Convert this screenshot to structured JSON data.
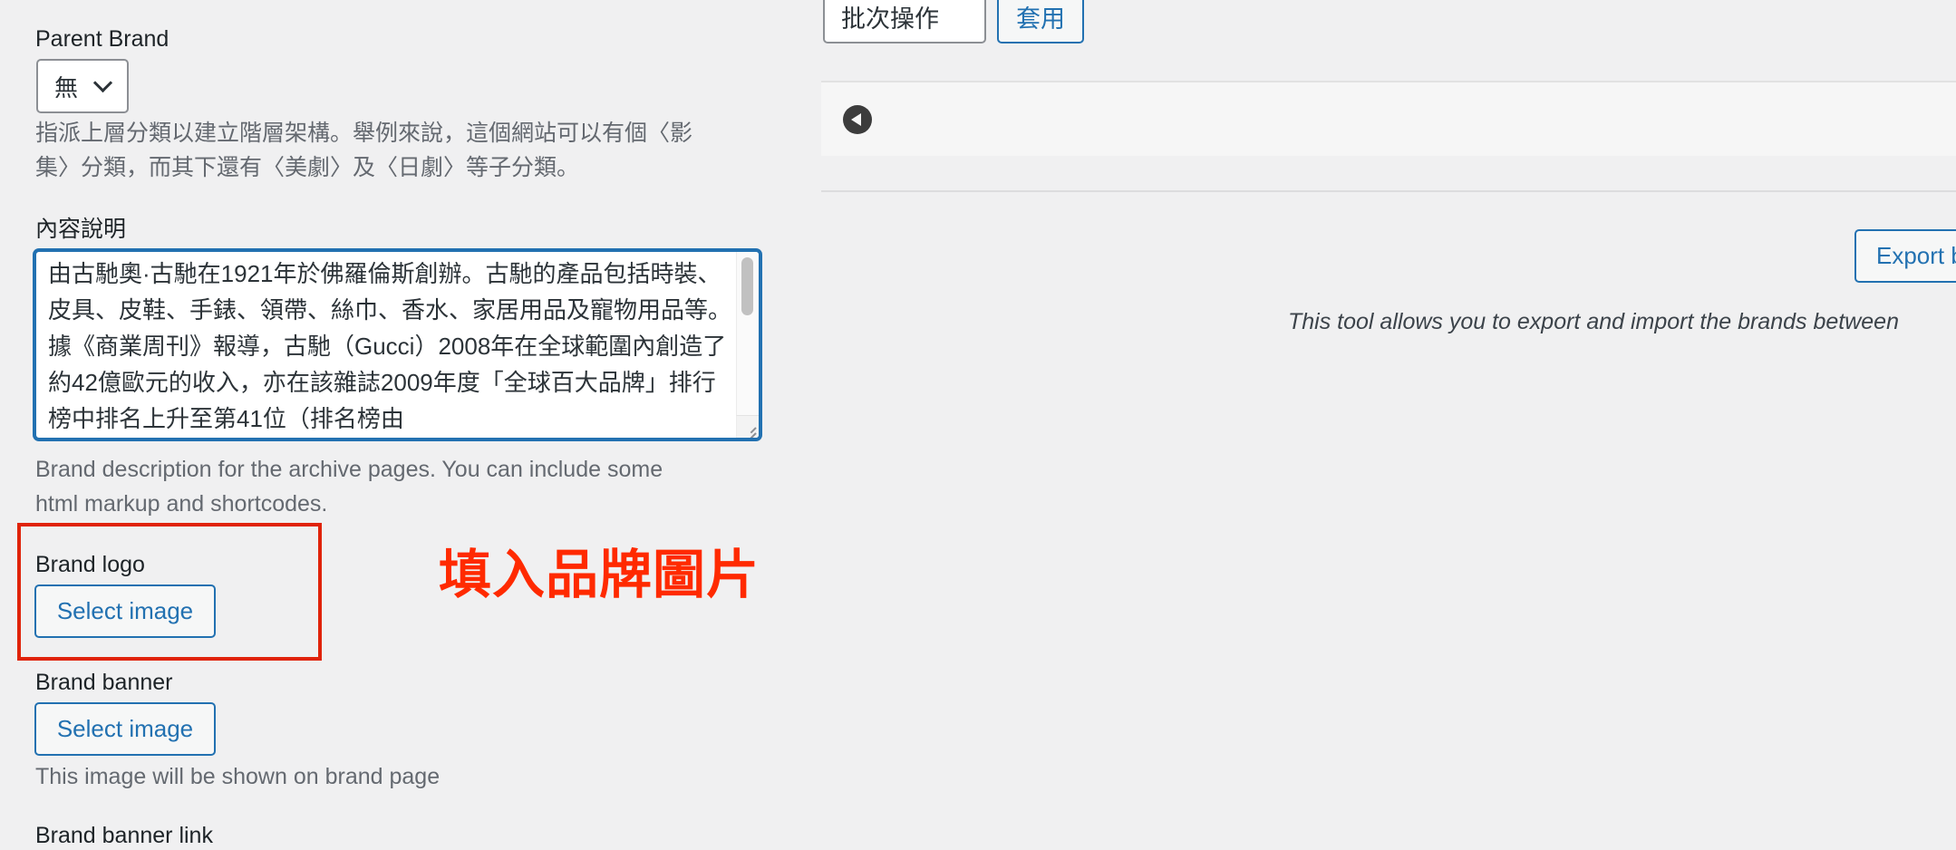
{
  "form": {
    "parent_brand": {
      "label": "Parent Brand",
      "selected": "無",
      "hint_line1": "指派上層分類以建立階層架構。舉例來說，這個網站可以有個〈影",
      "hint_line2": "集〉分類，而其下還有〈美劇〉及〈日劇〉等子分類。"
    },
    "description": {
      "label": "內容說明",
      "value": "由古馳奧·古馳在1921年於佛羅倫斯創辦。古馳的產品包括時裝、皮具、皮鞋、手錶、領帶、絲巾、香水、家居用品及寵物用品等。據《商業周刊》報導，古馳（Gucci）2008年在全球範圍內創造了約42億歐元的收入，亦在該雜誌2009年度「全球百大品牌」排行榜中排名上升至第41位（排名榜由",
      "hint_line1": "Brand description for the archive pages. You can include some",
      "hint_line2": "html markup and shortcodes."
    },
    "brand_logo": {
      "label": "Brand logo",
      "button": "Select image"
    },
    "brand_banner": {
      "label": "Brand banner",
      "button": "Select image",
      "hint": "This image will be shown on brand page"
    },
    "brand_banner_link": {
      "label": "Brand banner link"
    }
  },
  "annotation": {
    "text": "填入品牌圖片",
    "color": "#ff2a00"
  },
  "list": {
    "bulk_actions": {
      "selected": "批次操作"
    },
    "apply_button": "套用",
    "collapse_icon": "arrow-left-circle-icon"
  },
  "export_tool": {
    "button": "Export brands",
    "note": "This tool allows you to export and import the brands between"
  },
  "colors": {
    "accent": "#2271b1",
    "background": "#f0f0f1",
    "annotation_box": "#e0230a"
  }
}
